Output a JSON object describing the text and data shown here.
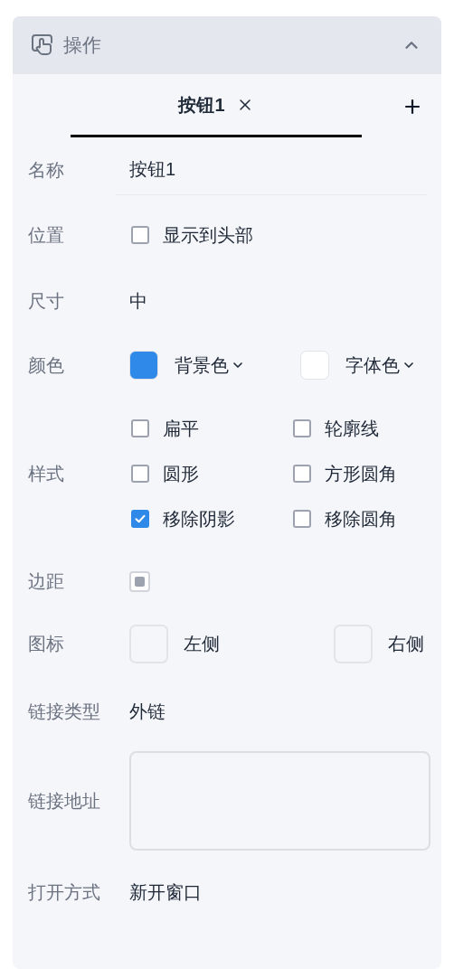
{
  "panel": {
    "title": "操作",
    "expanded": true
  },
  "tabs": [
    {
      "label": "按钮1",
      "selected": true,
      "closable": true
    }
  ],
  "rows": [
    {
      "kind": "input",
      "label": "名称",
      "value": "按钮1"
    },
    {
      "kind": "checkbox",
      "label": "位置",
      "options": [
        {
          "label": "显示到头部",
          "checked": false
        }
      ]
    },
    {
      "kind": "text",
      "label": "尺寸",
      "value": "中"
    },
    {
      "kind": "colors",
      "label": "颜色",
      "swatches": [
        {
          "label": "背景色",
          "color": "#2f89e8"
        },
        {
          "label": "字体色",
          "color": "#ffffff"
        }
      ]
    },
    {
      "kind": "checkbox",
      "label": "样式",
      "options": [
        {
          "label": "扁平",
          "checked": false
        },
        {
          "label": "轮廓线",
          "checked": false
        },
        {
          "label": "圆形",
          "checked": false
        },
        {
          "label": "方形圆角",
          "checked": false
        },
        {
          "label": "移除阴影",
          "checked": true
        },
        {
          "label": "移除圆角",
          "checked": false
        }
      ]
    },
    {
      "kind": "padding",
      "label": "边距"
    },
    {
      "kind": "icons",
      "label": "图标",
      "slots": [
        {
          "label": "左侧"
        },
        {
          "label": "右侧"
        }
      ]
    },
    {
      "kind": "text",
      "label": "链接类型",
      "value": "外链"
    },
    {
      "kind": "textarea",
      "label": "链接地址"
    },
    {
      "kind": "text",
      "label": "打开方式",
      "value": "新开窗口"
    }
  ]
}
